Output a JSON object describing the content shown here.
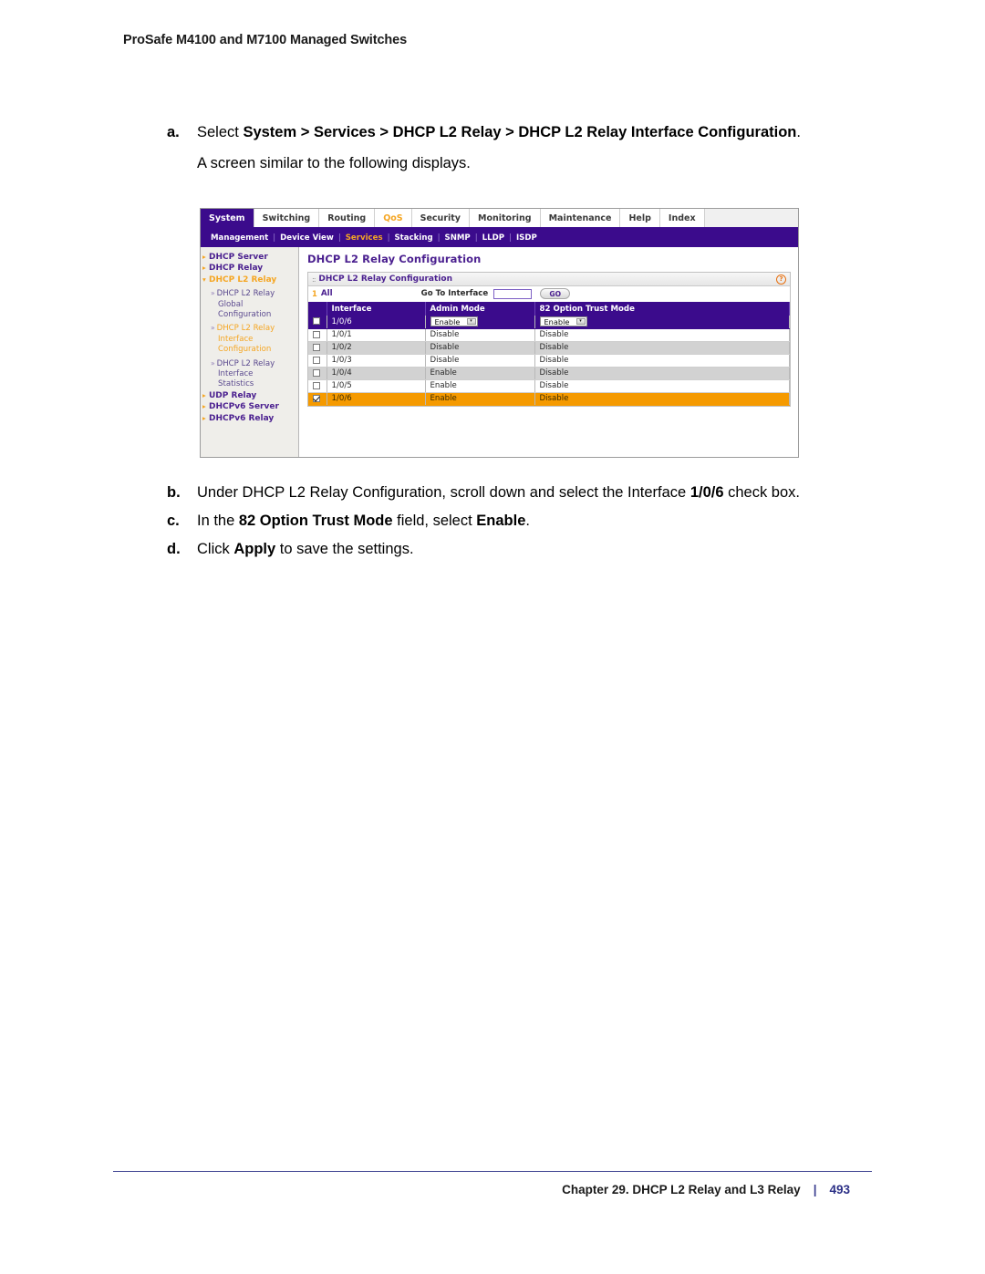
{
  "page_header": "ProSafe M4100 and M7100 Managed Switches",
  "steps": [
    {
      "marker": "a.",
      "segments": [
        {
          "text": "Select ",
          "bold": false
        },
        {
          "text": "System > Services > DHCP L2 Relay > DHCP L2 Relay Interface Configuration",
          "bold": true
        },
        {
          "text": ".",
          "bold": false
        }
      ]
    }
  ],
  "note": "A screen similar to the following displays.",
  "steps_after": [
    {
      "marker": "b.",
      "segments": [
        {
          "text": "Under DHCP L2 Relay Configuration, scroll down and select the Interface ",
          "bold": false
        },
        {
          "text": "1/0/6",
          "bold": true
        },
        {
          "text": " check box.",
          "bold": false
        }
      ]
    },
    {
      "marker": "c.",
      "segments": [
        {
          "text": "In the ",
          "bold": false
        },
        {
          "text": "82 Option Trust Mode",
          "bold": true
        },
        {
          "text": " field, select ",
          "bold": false
        },
        {
          "text": "Enable",
          "bold": true
        },
        {
          "text": ".",
          "bold": false
        }
      ]
    },
    {
      "marker": "d.",
      "segments": [
        {
          "text": "Click ",
          "bold": false
        },
        {
          "text": "Apply",
          "bold": true
        },
        {
          "text": " to save the settings.",
          "bold": false
        }
      ]
    }
  ],
  "screenshot": {
    "tabs": [
      {
        "label": "System",
        "state": "active"
      },
      {
        "label": "Switching",
        "state": "normal"
      },
      {
        "label": "Routing",
        "state": "normal"
      },
      {
        "label": "QoS",
        "state": "accent"
      },
      {
        "label": "Security",
        "state": "normal"
      },
      {
        "label": "Monitoring",
        "state": "normal"
      },
      {
        "label": "Maintenance",
        "state": "normal"
      },
      {
        "label": "Help",
        "state": "normal"
      },
      {
        "label": "Index",
        "state": "normal"
      }
    ],
    "subnav": [
      {
        "label": "Management",
        "state": "normal"
      },
      {
        "label": "Device View",
        "state": "normal"
      },
      {
        "label": "Services",
        "state": "accent"
      },
      {
        "label": "Stacking",
        "state": "normal"
      },
      {
        "label": "SNMP",
        "state": "normal"
      },
      {
        "label": "LLDP",
        "state": "normal"
      },
      {
        "label": "ISDP",
        "state": "normal"
      }
    ],
    "sidebar": [
      {
        "type": "l1",
        "label": "DHCP Server",
        "state": "normal"
      },
      {
        "type": "l1",
        "label": "DHCP Relay",
        "state": "normal"
      },
      {
        "type": "l1",
        "label": "DHCP L2 Relay",
        "state": "accent"
      },
      {
        "type": "l2",
        "label": "DHCP L2 Relay",
        "state": "normal"
      },
      {
        "type": "cont",
        "label": "Global",
        "state": "normal"
      },
      {
        "type": "cont",
        "label": "Configuration",
        "state": "normal"
      },
      {
        "type": "l2",
        "label": "DHCP L2 Relay",
        "state": "accent"
      },
      {
        "type": "cont",
        "label": "Interface",
        "state": "accent"
      },
      {
        "type": "cont",
        "label": "Configuration",
        "state": "accent"
      },
      {
        "type": "l2",
        "label": "DHCP L2 Relay",
        "state": "normal"
      },
      {
        "type": "cont",
        "label": "Interface",
        "state": "normal"
      },
      {
        "type": "cont",
        "label": "Statistics",
        "state": "normal"
      },
      {
        "type": "l1",
        "label": "UDP Relay",
        "state": "normal"
      },
      {
        "type": "l1",
        "label": "DHCPv6 Server",
        "state": "normal"
      },
      {
        "type": "l1",
        "label": "DHCPv6 Relay",
        "state": "normal"
      }
    ],
    "main_title": "DHCP L2 Relay Configuration",
    "panel": {
      "title": "DHCP L2 Relay Configuration",
      "help_glyph": "?",
      "grip_glyph": "::",
      "tool_number": "1",
      "tool_all": "All",
      "goto_label": "Go To Interface",
      "goto_value": "",
      "go_button": "GO",
      "columns": [
        "",
        "Interface",
        "Admin Mode",
        "82 Option Trust Mode"
      ],
      "rows": [
        {
          "style": "sel",
          "checked": false,
          "interface": "1/0/6",
          "admin_mode": "Enable",
          "trust_mode": "Enable",
          "control": "select"
        },
        {
          "style": "odd",
          "checked": false,
          "interface": "1/0/1",
          "admin_mode": "Disable",
          "trust_mode": "Disable",
          "control": "text"
        },
        {
          "style": "even",
          "checked": false,
          "interface": "1/0/2",
          "admin_mode": "Disable",
          "trust_mode": "Disable",
          "control": "text"
        },
        {
          "style": "odd",
          "checked": false,
          "interface": "1/0/3",
          "admin_mode": "Disable",
          "trust_mode": "Disable",
          "control": "text"
        },
        {
          "style": "even",
          "checked": false,
          "interface": "1/0/4",
          "admin_mode": "Enable",
          "trust_mode": "Disable",
          "control": "text"
        },
        {
          "style": "odd",
          "checked": false,
          "interface": "1/0/5",
          "admin_mode": "Enable",
          "trust_mode": "Disable",
          "control": "text"
        },
        {
          "style": "mark",
          "checked": true,
          "interface": "1/0/6",
          "admin_mode": "Enable",
          "trust_mode": "Disable",
          "control": "text"
        }
      ]
    }
  },
  "footer": {
    "chapter": "Chapter 29.  DHCP L2 Relay and L3 Relay",
    "separator": "|",
    "page_number": "493"
  },
  "colors": {
    "brand_purple": "#3b0b8c",
    "link_purple": "#4a1f8f",
    "accent_orange": "#f5a623",
    "row_highlight": "#f59a00",
    "footer_blue": "#2b2f86"
  }
}
